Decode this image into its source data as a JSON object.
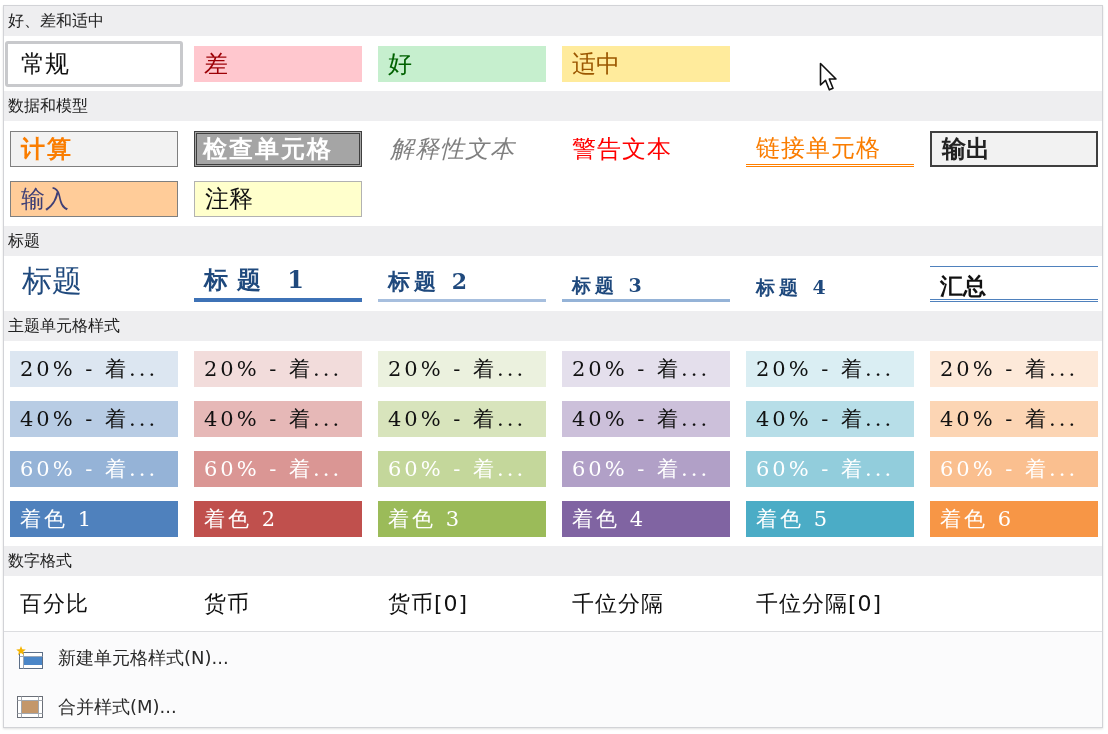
{
  "sections": [
    {
      "title": "好、差和适中",
      "items": [
        {
          "label": "常规",
          "kind": "normal",
          "selected": true
        },
        {
          "label": "差",
          "kind": "bad",
          "selected": false
        },
        {
          "label": "好",
          "kind": "good",
          "selected": false
        },
        {
          "label": "适中",
          "kind": "neutral",
          "selected": false
        }
      ]
    },
    {
      "title": "数据和模型",
      "items": [
        {
          "label": "计算",
          "kind": "calculation",
          "selected": false
        },
        {
          "label": "检查单元格",
          "kind": "check",
          "selected": false
        },
        {
          "label": "解释性文本",
          "kind": "explanatory",
          "selected": false
        },
        {
          "label": "警告文本",
          "kind": "warning",
          "selected": false
        },
        {
          "label": "链接单元格",
          "kind": "linked",
          "selected": false
        },
        {
          "label": "输出",
          "kind": "output",
          "selected": false
        },
        {
          "label": "输入",
          "kind": "input",
          "selected": false
        },
        {
          "label": "注释",
          "kind": "note",
          "selected": false
        }
      ]
    },
    {
      "title": "标题",
      "items": [
        {
          "label": "标题",
          "kind": "title",
          "selected": false
        },
        {
          "label": "标题 1",
          "kind": "heading1",
          "selected": false
        },
        {
          "label": "标题 2",
          "kind": "heading2",
          "selected": false
        },
        {
          "label": "标题 3",
          "kind": "heading3",
          "selected": false
        },
        {
          "label": "标题 4",
          "kind": "heading4",
          "selected": false
        },
        {
          "label": "汇总",
          "kind": "total",
          "selected": false
        }
      ]
    },
    {
      "title": "主题单元格样式",
      "items": [
        {
          "label": "20% - 着...",
          "kind": "tint20",
          "color": "#dce6f1",
          "selected": false
        },
        {
          "label": "20% - 着...",
          "kind": "tint20",
          "color": "#f2dcdb",
          "selected": false
        },
        {
          "label": "20% - 着...",
          "kind": "tint20",
          "color": "#ebf1de",
          "selected": false
        },
        {
          "label": "20% - 着...",
          "kind": "tint20",
          "color": "#e4dfec",
          "selected": false
        },
        {
          "label": "20% - 着...",
          "kind": "tint20",
          "color": "#daeef3",
          "selected": false
        },
        {
          "label": "20% - 着...",
          "kind": "tint20",
          "color": "#fde9d9",
          "selected": false
        },
        {
          "label": "40% - 着...",
          "kind": "tint40",
          "color": "#b8cce4",
          "selected": false
        },
        {
          "label": "40% - 着...",
          "kind": "tint40",
          "color": "#e6b8b7",
          "selected": false
        },
        {
          "label": "40% - 着...",
          "kind": "tint40",
          "color": "#d8e4bc",
          "selected": false
        },
        {
          "label": "40% - 着...",
          "kind": "tint40",
          "color": "#ccc0da",
          "selected": false
        },
        {
          "label": "40% - 着...",
          "kind": "tint40",
          "color": "#b7dee8",
          "selected": false
        },
        {
          "label": "40% - 着...",
          "kind": "tint40",
          "color": "#fcd5b4",
          "selected": false
        },
        {
          "label": "60% - 着...",
          "kind": "tint60",
          "color": "#95b3d7",
          "selected": false
        },
        {
          "label": "60% - 着...",
          "kind": "tint60",
          "color": "#da9694",
          "selected": false
        },
        {
          "label": "60% - 着...",
          "kind": "tint60",
          "color": "#c4d79b",
          "selected": false
        },
        {
          "label": "60% - 着...",
          "kind": "tint60",
          "color": "#b1a0c7",
          "selected": false
        },
        {
          "label": "60% - 着...",
          "kind": "tint60",
          "color": "#92cddc",
          "selected": false
        },
        {
          "label": "60% - 着...",
          "kind": "tint60",
          "color": "#fabf8f",
          "selected": false
        },
        {
          "label": "着色 1",
          "kind": "accent",
          "color": "#4f81bd",
          "selected": false
        },
        {
          "label": "着色 2",
          "kind": "accent",
          "color": "#c0504d",
          "selected": false
        },
        {
          "label": "着色 3",
          "kind": "accent",
          "color": "#9bbb59",
          "selected": false
        },
        {
          "label": "着色 4",
          "kind": "accent",
          "color": "#8064a2",
          "selected": false
        },
        {
          "label": "着色 5",
          "kind": "accent",
          "color": "#4bacc6",
          "selected": false
        },
        {
          "label": "着色 6",
          "kind": "accent",
          "color": "#f79646",
          "selected": false
        }
      ]
    },
    {
      "title": "数字格式",
      "items": [
        {
          "label": "百分比",
          "kind": "plain",
          "selected": false
        },
        {
          "label": "货币",
          "kind": "plain",
          "selected": false
        },
        {
          "label": "货币[0]",
          "kind": "plain",
          "selected": false
        },
        {
          "label": "千位分隔",
          "kind": "plain",
          "selected": false
        },
        {
          "label": "千位分隔[0]",
          "kind": "plain",
          "selected": false
        }
      ]
    }
  ],
  "menu": [
    {
      "label": "新建单元格样式(N)...",
      "kind": "new"
    },
    {
      "label": "合并样式(M)...",
      "kind": "merge"
    }
  ]
}
